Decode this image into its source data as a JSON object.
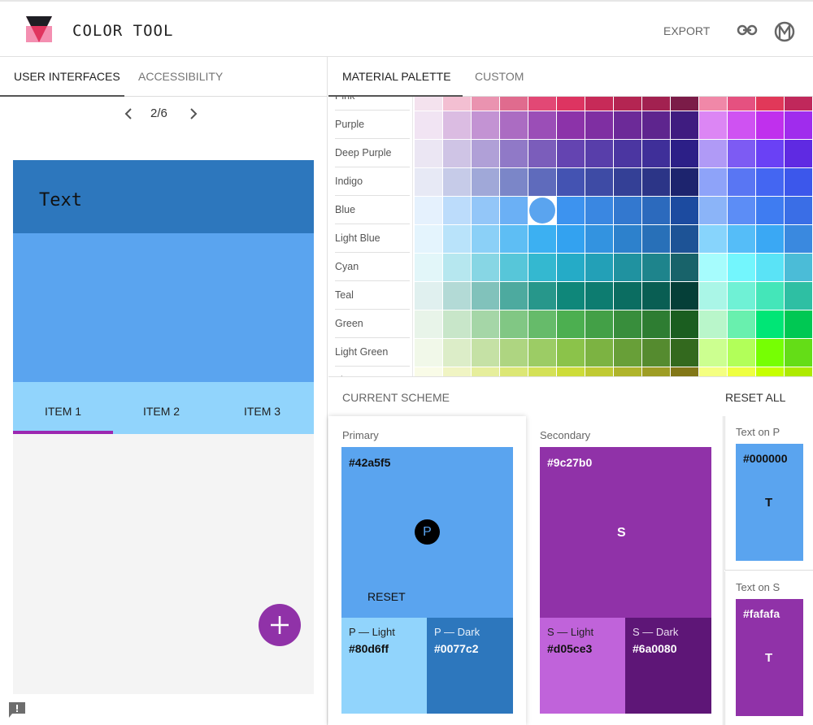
{
  "header": {
    "title": "COLOR TOOL",
    "export_label": "EXPORT",
    "icons": [
      "logo-icon",
      "link-icon",
      "material-logo-icon"
    ]
  },
  "left_panel": {
    "tabs": [
      {
        "label": "USER INTERFACES",
        "active": true
      },
      {
        "label": "ACCESSIBILITY",
        "active": false
      }
    ],
    "pager": {
      "current": "2/6",
      "prev_icon": "chevron-left-icon",
      "next_icon": "chevron-right-icon"
    },
    "preview": {
      "appbar_text": "Text",
      "tabs": [
        {
          "label": "ITEM 1",
          "active": true
        },
        {
          "label": "ITEM 2",
          "active": false
        },
        {
          "label": "ITEM 3",
          "active": false
        }
      ],
      "fab_icon": "plus-icon",
      "colors": {
        "appbar": "#2d77bd",
        "hero": "#5aa4ef",
        "tabs": "#91d4fc",
        "indicator": "#9c27b0",
        "fab": "#9032a8",
        "background": "#f4f4f4"
      }
    }
  },
  "right_panel": {
    "tabs": [
      {
        "label": "MATERIAL PALETTE",
        "active": true
      },
      {
        "label": "CUSTOM",
        "active": false
      }
    ],
    "palette": {
      "rows": [
        {
          "name": "Pink",
          "colors": [
            "#f4e2ee",
            "#f3bfd2",
            "#ea93b0",
            "#e06b8e",
            "#e24875",
            "#dd3461",
            "#c72a58",
            "#b42552",
            "#a22150",
            "#7b1c48",
            "#f088a8",
            "#e55180",
            "#e13859",
            "#c0285b"
          ]
        },
        {
          "name": "Purple",
          "colors": [
            "#f1e4f3",
            "#dbbce2",
            "#c393d3",
            "#ab6cc2",
            "#9b4eb7",
            "#8c33a9",
            "#7f2fa2",
            "#6c2a98",
            "#5e258e",
            "#3f1c80",
            "#dc86f4",
            "#cf52f2",
            "#c030ed",
            "#a02ced"
          ]
        },
        {
          "name": "Deep Purple",
          "colors": [
            "#ebe6f3",
            "#cfc4e5",
            "#b0a0d7",
            "#9079c7",
            "#7b5dbb",
            "#6444b1",
            "#583eaa",
            "#4b36a1",
            "#3f2f99",
            "#2c1f87",
            "#b09af6",
            "#7d5bf3",
            "#6a41f5",
            "#5f2ae2"
          ]
        },
        {
          "name": "Indigo",
          "colors": [
            "#e7e9f5",
            "#c6cbe8",
            "#a0a8d8",
            "#7b86c8",
            "#5f6bbc",
            "#4453b2",
            "#3e4ba5",
            "#344096",
            "#2c3587",
            "#1d246e",
            "#8ea3f9",
            "#5976f3",
            "#4466f2",
            "#3c57eb"
          ]
        },
        {
          "name": "Blue",
          "colors": [
            "#e5f1fd",
            "#bcdcfb",
            "#93c6f8",
            "#6bb0f5",
            "#5aa4ef",
            "#3d93ef",
            "#3a87e1",
            "#3378cf",
            "#2c6abd",
            "#1c4ba0",
            "#8bb4f8",
            "#5c8df6",
            "#3f7cf1",
            "#3a6ee6"
          ]
        },
        {
          "name": "Light Blue",
          "colors": [
            "#e4f4fd",
            "#b9e3fa",
            "#8bd0f7",
            "#5ebef4",
            "#3cb0f2",
            "#33a2f0",
            "#3393e0",
            "#2d81cc",
            "#2870b8",
            "#1d5396",
            "#87d4fc",
            "#55bdf8",
            "#3aa8f4",
            "#3a89df"
          ]
        },
        {
          "name": "Cyan",
          "colors": [
            "#e2f6f9",
            "#b6e7ef",
            "#87d6e4",
            "#57c6d9",
            "#34b8d0",
            "#25abc7",
            "#23a0b7",
            "#2092a0",
            "#1e848c",
            "#18636a",
            "#a6fcfd",
            "#73f6fd",
            "#5ae3f6",
            "#4bbcd7"
          ]
        },
        {
          "name": "Teal",
          "colors": [
            "#e0f0ef",
            "#b3dad6",
            "#81c2bb",
            "#4daa9f",
            "#27978b",
            "#0f877a",
            "#0d7c70",
            "#0b6d61",
            "#095e53",
            "#053f38",
            "#aaf6e7",
            "#6ff1d5",
            "#44e6b9",
            "#2ebfa3"
          ]
        },
        {
          "name": "Green",
          "colors": [
            "#e8f4e9",
            "#c8e6c9",
            "#a5d6a7",
            "#81c784",
            "#66bb6a",
            "#4caf50",
            "#43a047",
            "#388e3c",
            "#2e7d32",
            "#1b5e20",
            "#b9f6ca",
            "#69f0ae",
            "#00e676",
            "#00c853"
          ]
        },
        {
          "name": "Light Green",
          "colors": [
            "#f1f8e9",
            "#dcedc8",
            "#c5e1a5",
            "#aed581",
            "#9ccc65",
            "#8bc34a",
            "#7cb342",
            "#689f38",
            "#558b2f",
            "#33691e",
            "#ccff90",
            "#b2ff59",
            "#76ff03",
            "#64dd17"
          ]
        },
        {
          "name": "Lime",
          "colors": [
            "#f9fbe7",
            "#f0f4c3",
            "#e6ee9c",
            "#dce775",
            "#d4e157",
            "#cddc39",
            "#c0ca33",
            "#afb42b",
            "#9e9d24",
            "#827717",
            "#f4ff81",
            "#eeff41",
            "#c6ff00",
            "#aeea00"
          ]
        }
      ],
      "selected": {
        "row": "Blue",
        "index": 4
      }
    },
    "scheme": {
      "title": "CURRENT SCHEME",
      "reset_all": "RESET ALL",
      "primary": {
        "label": "Primary",
        "hex": "#42a5f5",
        "badge": "P",
        "reset": "RESET",
        "light": {
          "label": "P — Light",
          "hex": "#80d6ff"
        },
        "dark": {
          "label": "P — Dark",
          "hex": "#0077c2"
        }
      },
      "secondary": {
        "label": "Secondary",
        "hex": "#9c27b0",
        "badge": "S",
        "light": {
          "label": "S — Light",
          "hex": "#d05ce3"
        },
        "dark": {
          "label": "S — Dark",
          "hex": "#6a0080"
        }
      },
      "text_on_p": {
        "label": "Text on P",
        "hex": "#000000",
        "glyph": "T"
      },
      "text_on_s": {
        "label": "Text on S",
        "hex": "#fafafa",
        "glyph": "T"
      }
    }
  }
}
